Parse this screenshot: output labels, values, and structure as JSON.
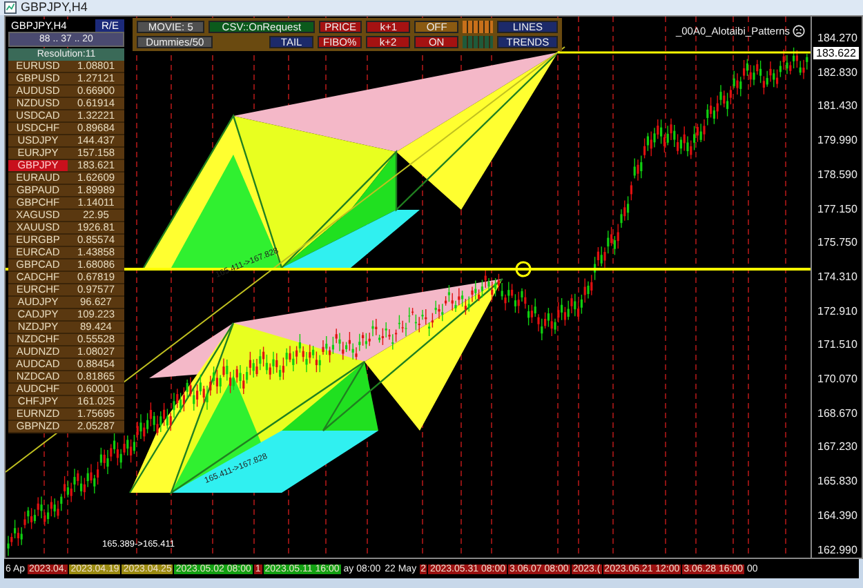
{
  "window": {
    "title": "GBPJPY,H4"
  },
  "panel": {
    "symbol": "GBPJPY,H4",
    "mode": "R/E",
    "levels": "88 .. 37 .. 20",
    "resolution": "Resolution:11",
    "rows": [
      {
        "pair": "EURUSD",
        "price": "1.08801",
        "selected": false
      },
      {
        "pair": "GBPUSD",
        "price": "1.27121",
        "selected": false
      },
      {
        "pair": "AUDUSD",
        "price": "0.66900",
        "selected": false
      },
      {
        "pair": "NZDUSD",
        "price": "0.61914",
        "selected": false
      },
      {
        "pair": "USDCAD",
        "price": "1.32221",
        "selected": false
      },
      {
        "pair": "USDCHF",
        "price": "0.89684",
        "selected": false
      },
      {
        "pair": "USDJPY",
        "price": "144.437",
        "selected": false
      },
      {
        "pair": "EURJPY",
        "price": "157.158",
        "selected": false
      },
      {
        "pair": "GBPJPY",
        "price": "183.621",
        "selected": true
      },
      {
        "pair": "EURAUD",
        "price": "1.62609",
        "selected": false
      },
      {
        "pair": "GBPAUD",
        "price": "1.89989",
        "selected": false
      },
      {
        "pair": "GBPCHF",
        "price": "1.14011",
        "selected": false
      },
      {
        "pair": "XAGUSD",
        "price": "22.95",
        "selected": false
      },
      {
        "pair": "XAUUSD",
        "price": "1926.81",
        "selected": false
      },
      {
        "pair": "EURGBP",
        "price": "0.85574",
        "selected": false
      },
      {
        "pair": "EURCAD",
        "price": "1.43858",
        "selected": false
      },
      {
        "pair": "GBPCAD",
        "price": "1.68086",
        "selected": false
      },
      {
        "pair": "CADCHF",
        "price": "0.67819",
        "selected": false
      },
      {
        "pair": "EURCHF",
        "price": "0.97577",
        "selected": false
      },
      {
        "pair": "AUDJPY",
        "price": "96.627",
        "selected": false
      },
      {
        "pair": "CADJPY",
        "price": "109.223",
        "selected": false
      },
      {
        "pair": "NZDJPY",
        "price": "89.424",
        "selected": false
      },
      {
        "pair": "NZDCHF",
        "price": "0.55528",
        "selected": false
      },
      {
        "pair": "AUDNZD",
        "price": "1.08027",
        "selected": false
      },
      {
        "pair": "AUDCAD",
        "price": "0.88454",
        "selected": false
      },
      {
        "pair": "NZDCAD",
        "price": "0.81865",
        "selected": false
      },
      {
        "pair": "AUDCHF",
        "price": "0.60001",
        "selected": false
      },
      {
        "pair": "CHFJPY",
        "price": "161.025",
        "selected": false
      },
      {
        "pair": "EURNZD",
        "price": "1.75695",
        "selected": false
      },
      {
        "pair": "GBPNZD",
        "price": "2.05287",
        "selected": false
      }
    ]
  },
  "toolbar": [
    [
      {
        "kind": "button",
        "label": "MOVIE: 5",
        "color": "#505050"
      },
      {
        "kind": "button",
        "label": "CSV::OnRequest",
        "color": "#0b5a1c"
      },
      {
        "kind": "button",
        "label": "PRICE",
        "color": "#a51212"
      },
      {
        "kind": "button",
        "label": "k+1",
        "color": "#a51212"
      },
      {
        "kind": "button",
        "label": "OFF",
        "color": "#8a5a12"
      },
      {
        "kind": "swatch",
        "color": "#c8701a"
      },
      {
        "kind": "button",
        "label": "LINES",
        "color": "#1c2a6a"
      }
    ],
    [
      {
        "kind": "button",
        "label": "Dummies/50",
        "color": "#505050"
      },
      {
        "kind": "gap"
      },
      {
        "kind": "button",
        "label": "TAIL",
        "color": "#1c2a6a"
      },
      {
        "kind": "button",
        "label": "FIBO%",
        "color": "#a51212"
      },
      {
        "kind": "button",
        "label": "k+2",
        "color": "#a51212"
      },
      {
        "kind": "button",
        "label": "ON",
        "color": "#a51212"
      },
      {
        "kind": "swatch",
        "color": "#1f5a3a"
      },
      {
        "kind": "button",
        "label": "TRENDS",
        "color": "#1c2a6a"
      }
    ]
  ],
  "indicator": {
    "name": "_00A0_Alotaibi_Patterns"
  },
  "pattern_labels": [
    "165.411->167.828",
    "165.411->167.828",
    "165.389->165.411"
  ],
  "price_axis": {
    "ticks": [
      "184.270",
      "182.830",
      "181.430",
      "179.990",
      "178.590",
      "177.150",
      "175.750",
      "174.310",
      "172.910",
      "171.510",
      "170.070",
      "168.670",
      "167.230",
      "165.830",
      "164.390",
      "162.990"
    ],
    "current": "183.622"
  },
  "time_axis": [
    {
      "text": "6 Ap"
    },
    {
      "text": "2023.04.",
      "color": "#9a1010"
    },
    {
      "text": "2023.04.19",
      "color": "#9a8a10"
    },
    {
      "text": "2023.04.25",
      "color": "#9a8a10"
    },
    {
      "text": "2023.05.02 08:00",
      "color": "#12a012"
    },
    {
      "text": "1",
      "color": "#9a1010"
    },
    {
      "text": "2023.05.11 16:00",
      "color": "#12a012"
    },
    {
      "text": "ay 08:00"
    },
    {
      "text": "22 May"
    },
    {
      "text": "2",
      "color": "#9a1010"
    },
    {
      "text": "2023.05.31 08:00",
      "color": "#9a1010"
    },
    {
      "text": "3.06.07 08:00",
      "color": "#9a1010"
    },
    {
      "text": "2023.(",
      "color": "#9a1010"
    },
    {
      "text": "2023.06.21 12:00",
      "color": "#9a1010"
    },
    {
      "text": "3.06.28 16:00",
      "color": "#9a1010"
    },
    {
      "text": "00"
    }
  ]
}
